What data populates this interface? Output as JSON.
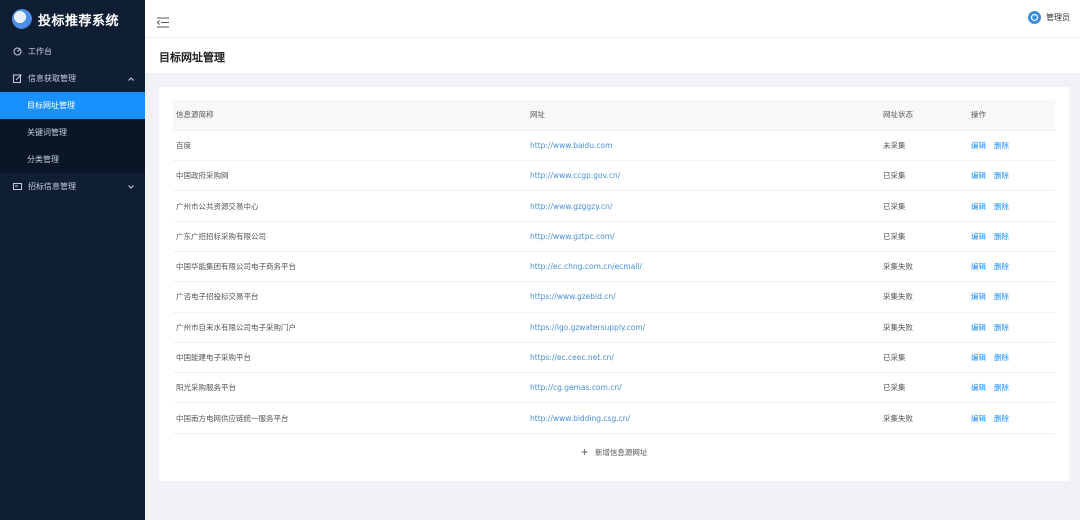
{
  "app": {
    "title": "投标推荐系统"
  },
  "sidebar": {
    "items": [
      {
        "label": "工作台"
      },
      {
        "label": "信息获取管理"
      },
      {
        "label": "招标信息管理"
      }
    ],
    "sub_items": [
      {
        "label": "目标网址管理"
      },
      {
        "label": "关键词管理"
      },
      {
        "label": "分类管理"
      }
    ]
  },
  "topbar": {
    "user_name": "管理员"
  },
  "page": {
    "title": "目标网址管理"
  },
  "table": {
    "columns": [
      "信息源简称",
      "网址",
      "网址状态",
      "操作"
    ],
    "edit_label": "编辑",
    "delete_label": "删除",
    "rows": [
      {
        "name": "百度",
        "url": "http://www.baidu.com",
        "status": "未采集"
      },
      {
        "name": "中国政府采购网",
        "url": "http://www.ccgp.gov.cn/",
        "status": "已采集"
      },
      {
        "name": "广州市公共资源交易中心",
        "url": "http://www.gzggzy.cn/",
        "status": "已采集"
      },
      {
        "name": "广东广招招标采购有限公司",
        "url": "http://www.gztpc.com/",
        "status": "已采集"
      },
      {
        "name": "中国华能集团有限公司电子商务平台",
        "url": "http://ec.chng.com.cn/ecmall/",
        "status": "采集失败"
      },
      {
        "name": "广咨电子招投标交易平台",
        "url": "https://www.gzebid.cn/",
        "status": "采集失败"
      },
      {
        "name": "广州市自来水有限公司电子采购门户",
        "url": "https://igo.gzwatersupply.com/",
        "status": "采集失败"
      },
      {
        "name": "中国能建电子采购平台",
        "url": "https://ec.ceec.net.cn/",
        "status": "已采集"
      },
      {
        "name": "阳光采购服务平台",
        "url": "http://cg.gemas.com.cn/",
        "status": "已采集"
      },
      {
        "name": "中国南方电网供应链统一服务平台",
        "url": "http://www.bidding.csg.cn/",
        "status": "采集失败"
      }
    ],
    "add_label": "新增信息源网址"
  },
  "colors": {
    "sidebar_bg": "#0f1e33",
    "accent": "#1890ff",
    "link": "#4a90d9"
  }
}
